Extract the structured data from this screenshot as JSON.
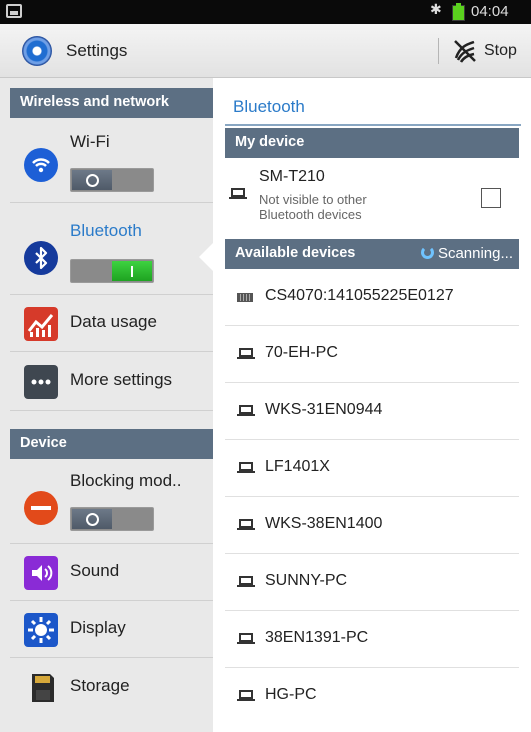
{
  "status_bar": {
    "image_icon": "image-icon",
    "bluetooth_icon": "bluetooth-icon",
    "battery_color": "#5ad11e",
    "time": "04:04"
  },
  "action_bar": {
    "icon": "settings-gear-icon",
    "title": "Settings",
    "stop_icon": "stop-scan-icon",
    "stop_label": "Stop"
  },
  "sidebar": {
    "sections": [
      {
        "label": "Wireless and network"
      },
      {
        "label": "Device"
      }
    ],
    "items": [
      {
        "label": "Wi-Fi",
        "icon": "wifi-icon",
        "toggle": "off"
      },
      {
        "label": "Bluetooth",
        "icon": "bluetooth-icon",
        "toggle": "on",
        "selected": true
      },
      {
        "label": "Data usage",
        "icon": "data-usage-icon"
      },
      {
        "label": "More settings",
        "icon": "more-settings-icon"
      },
      {
        "label": "Blocking mod..",
        "icon": "blocking-mode-icon",
        "toggle": "off"
      },
      {
        "label": "Sound",
        "icon": "sound-icon"
      },
      {
        "label": "Display",
        "icon": "display-icon"
      },
      {
        "label": "Storage",
        "icon": "storage-icon"
      }
    ]
  },
  "bluetooth_panel": {
    "title": "Bluetooth",
    "my_device_header": "My device",
    "my_device": {
      "name": "SM-T210",
      "subtitle": "Not visible to other Bluetooth devices",
      "checked": false
    },
    "available_header": "Available devices",
    "scanning_label": "Scanning...",
    "devices": [
      {
        "name": "CS4070:141055225E0127",
        "icon": "keyboard-icon"
      },
      {
        "name": "70-EH-PC",
        "icon": "laptop-icon"
      },
      {
        "name": "WKS-31EN0944",
        "icon": "laptop-icon"
      },
      {
        "name": "LF1401X",
        "icon": "laptop-icon"
      },
      {
        "name": "WKS-38EN1400",
        "icon": "laptop-icon"
      },
      {
        "name": "SUNNY-PC",
        "icon": "laptop-icon"
      },
      {
        "name": "38EN1391-PC",
        "icon": "laptop-icon"
      },
      {
        "name": "HG-PC",
        "icon": "laptop-icon"
      }
    ]
  },
  "colors": {
    "section_header": "#5c6f83",
    "accent_blue": "#2b7bc9",
    "toggle_on": "#2cbf2f"
  }
}
